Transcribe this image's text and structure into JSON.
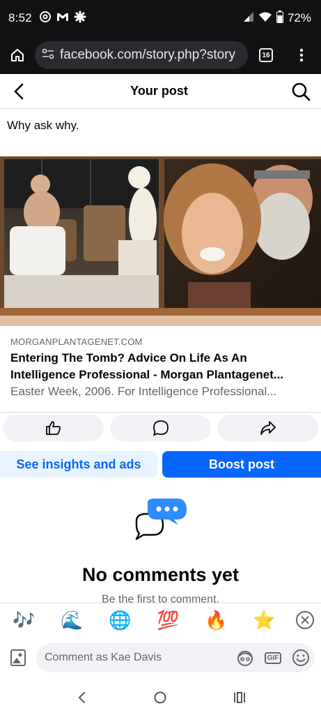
{
  "status_bar": {
    "time": "8:52",
    "battery": "72%",
    "icons": [
      "threads-icon",
      "gmail-icon",
      "pinwheel-icon",
      "signal-icon",
      "wifi-icon",
      "battery-icon"
    ]
  },
  "browser": {
    "url": "facebook.com/story.php?story",
    "tab_count": "16"
  },
  "header": {
    "title": "Your post"
  },
  "post": {
    "text": "Why ask why."
  },
  "link_preview": {
    "domain": "MORGANPLANTAGENET.COM",
    "title_line1": "Entering The Tomb? Advice On Life As An",
    "title_line2": "Intelligence Professional - Morgan Plantagenet...",
    "description": "Easter Week, 2006. For Intelligence Professional..."
  },
  "actions": {
    "insights_label": "See insights and ads",
    "boost_label": "Boost post"
  },
  "comments": {
    "empty_title": "No comments yet",
    "empty_subtitle": "Be the first to comment."
  },
  "emoji_bar": [
    "🎶",
    "🌊",
    "🌐",
    "💯",
    "🔥",
    "⭐"
  ],
  "composer": {
    "placeholder": "Comment as Kae Davis",
    "gif_label": "GIF"
  },
  "colors": {
    "accent": "#0866ff",
    "accent_light": "#e7f3ff",
    "muted": "#65676b",
    "surface": "#f0f2f5",
    "dark_bar": "#111214"
  }
}
